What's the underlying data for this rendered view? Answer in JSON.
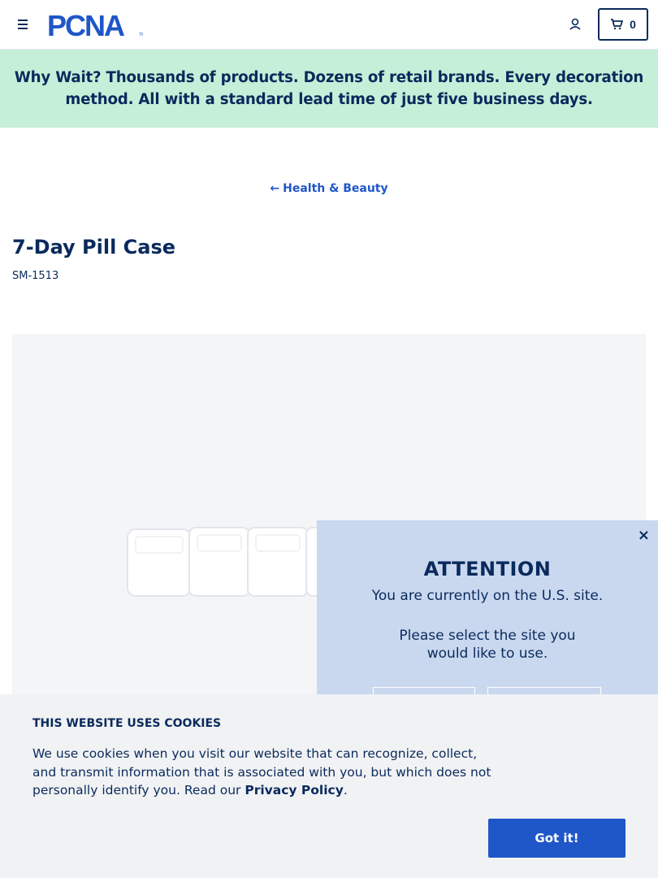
{
  "header": {
    "logo_text": "PCNA",
    "cart_count": "0"
  },
  "promo": {
    "lead": "Why Wait?",
    "text": " Thousands of products. Dozens of retail brands. Every decoration method. All with a standard lead time of just five business days."
  },
  "breadcrumb": {
    "arrow": "←",
    "label": "Health & Beauty"
  },
  "product": {
    "title": "7-Day Pill Case",
    "sku": "SM-1513"
  },
  "attention": {
    "close": "×",
    "title": "ATTENTION",
    "current_site": "You are currently on the U.S. site.",
    "prompt": "Please select the site you would like to use."
  },
  "cookie": {
    "title": "THIS WEBSITE USES COOKIES",
    "text_before": "We use cookies when you visit our website that can recognize, collect, and transmit information that is associated with you, but which does not personally identify you. Read our ",
    "link": "Privacy Policy",
    "text_after": ".",
    "button": "Got it!"
  },
  "colors": {
    "navy": "#0a2a5c",
    "blue": "#1f56c8",
    "promo_bg": "#c5efd8",
    "attention_bg": "#c9d8ef",
    "cookie_bg": "#f1f2f4"
  }
}
